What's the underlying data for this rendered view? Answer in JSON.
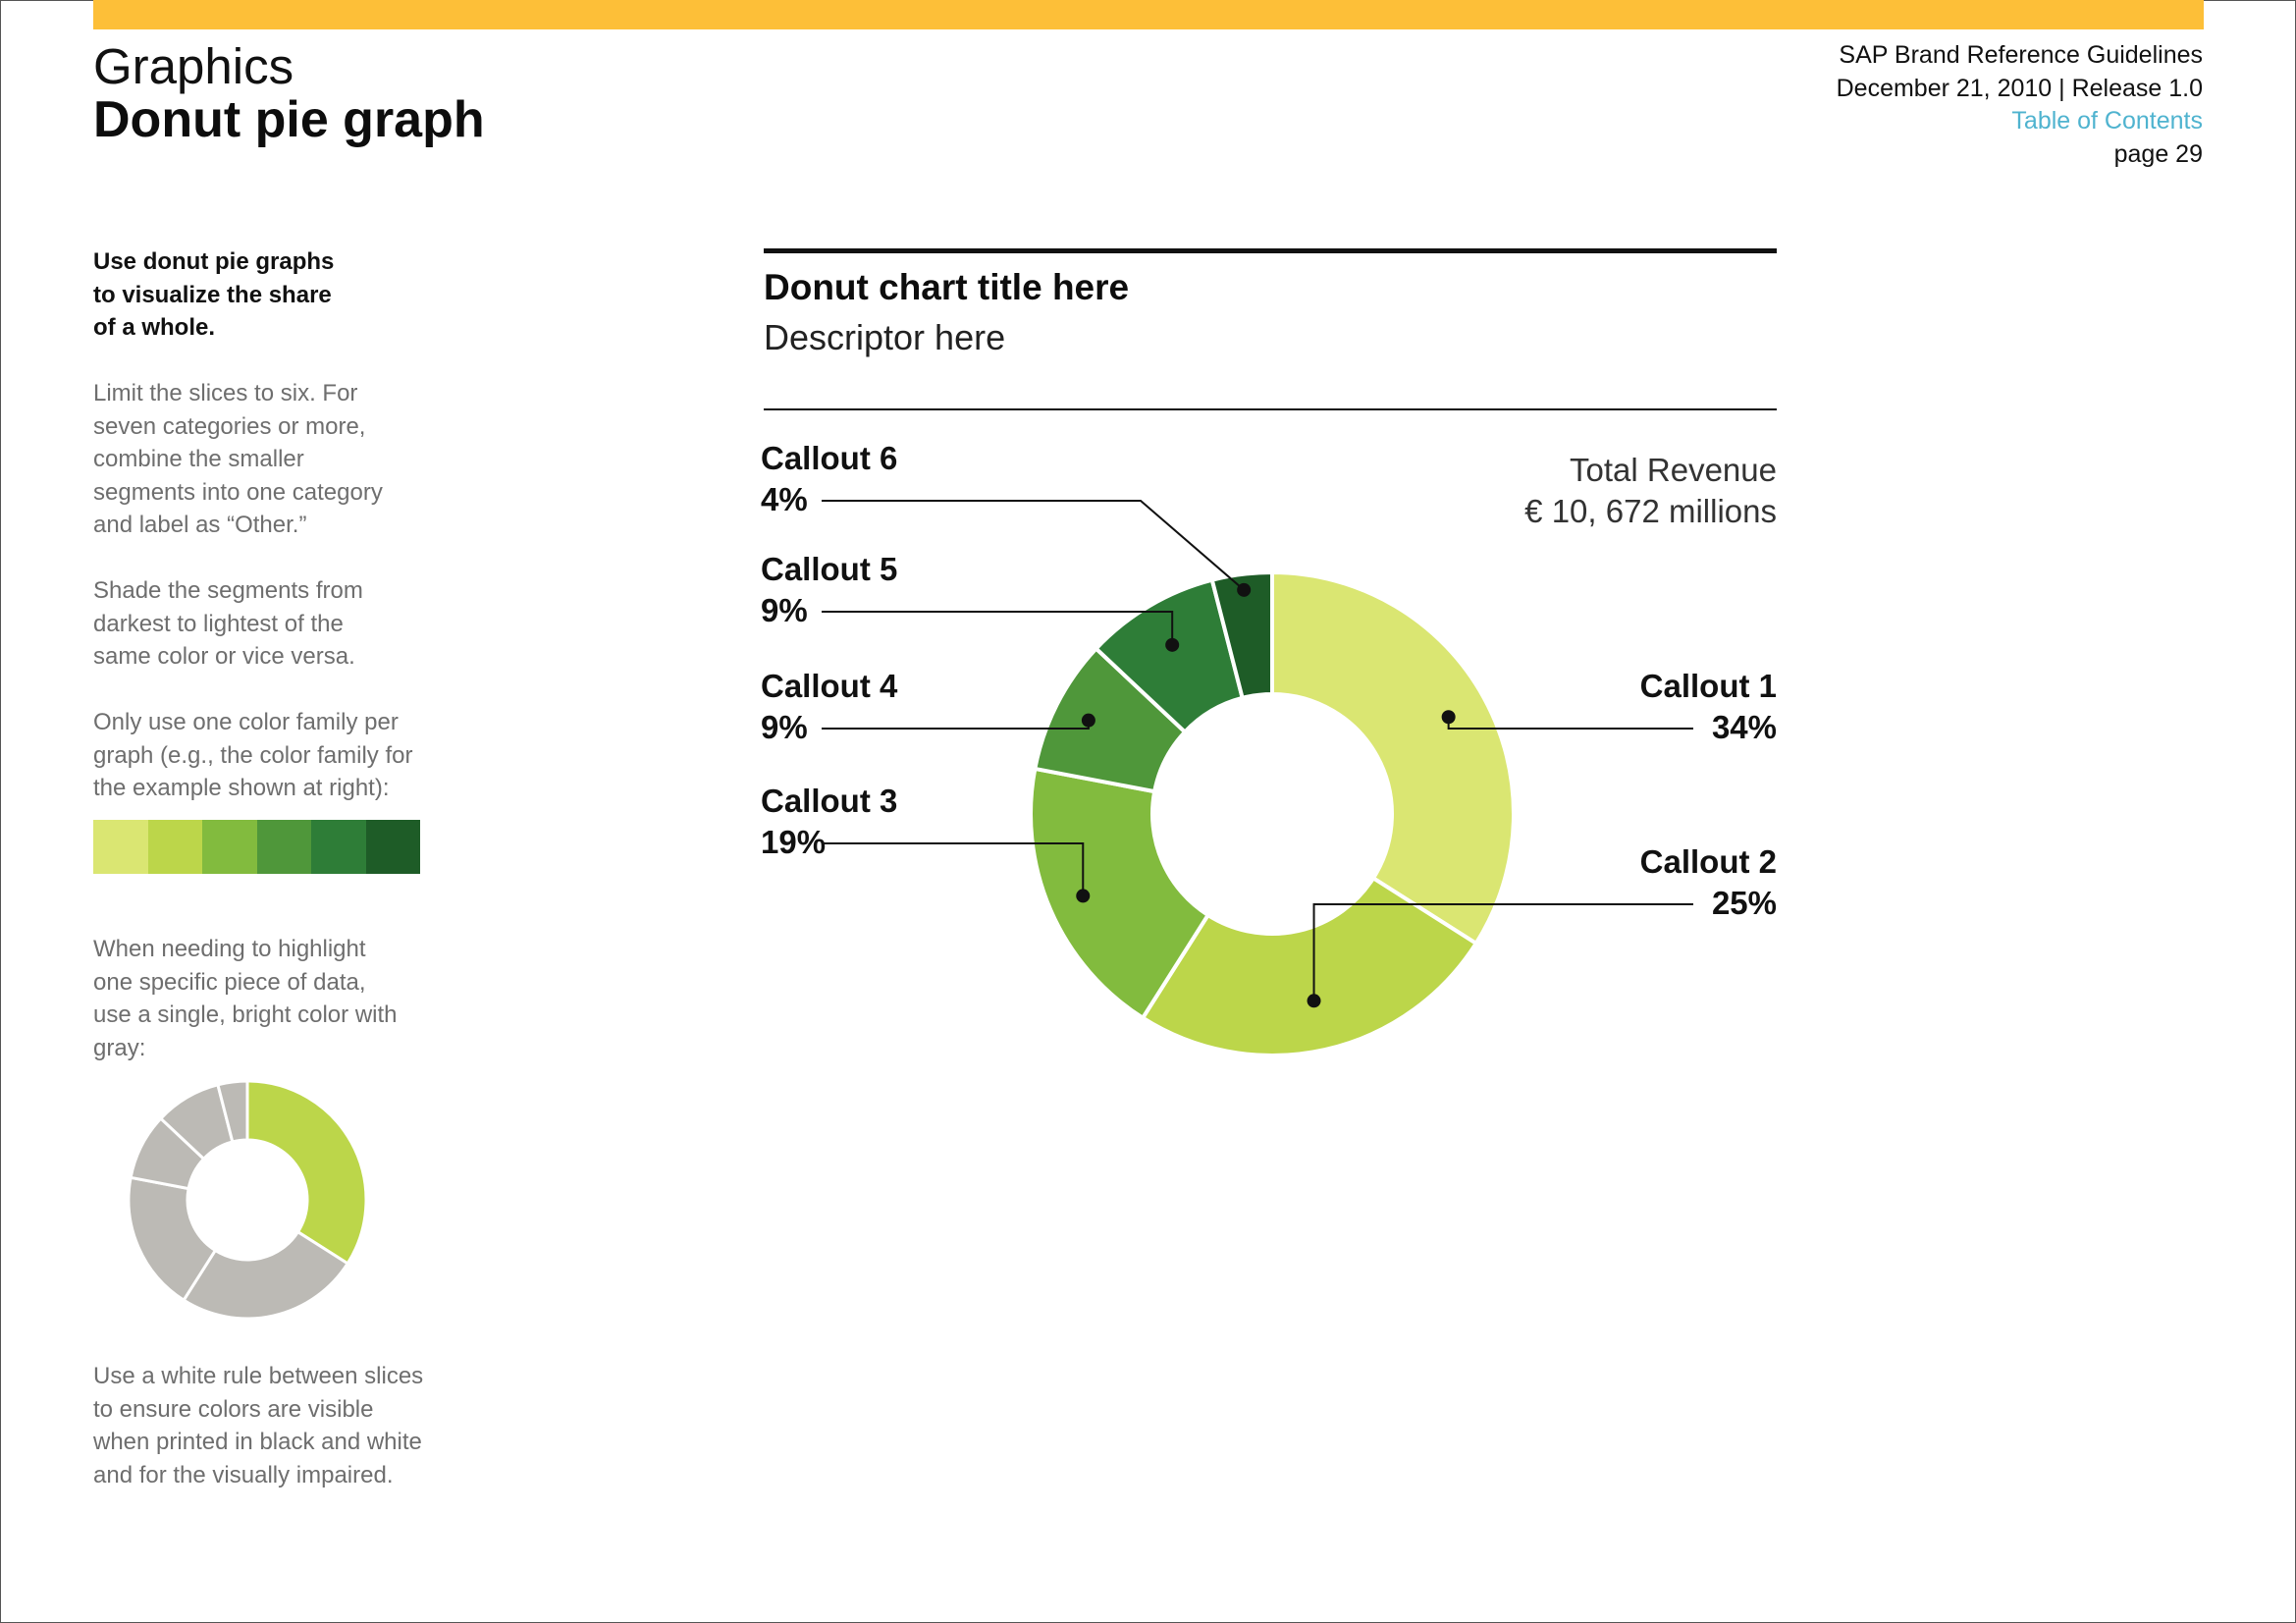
{
  "header": {
    "section": "Graphics",
    "title": "Donut pie graph",
    "doc_title": "SAP Brand Reference Guidelines",
    "date_release": "December 21, 2010 | Release 1.0",
    "toc_link": "Table of Contents",
    "page": "page 29"
  },
  "colors": {
    "accent_bar": "#FDBF38",
    "toc_link": "#4FB3CF",
    "green_family": [
      "#DAE672",
      "#BCD64A",
      "#82BB3E",
      "#4F973A",
      "#2E7D37",
      "#1E5C27"
    ],
    "highlight_gray": "#BCBAB5"
  },
  "sidebar": {
    "lead": "Use donut pie graphs to visualize the share of a whole.",
    "p1": "Limit the slices to six. For seven categories or more, combine the smaller segments into one category and label as “Other.”",
    "p2": "Shade the segments from darkest to lightest of the same color or vice versa.",
    "p3": "Only use one color family per graph (e.g., the color family for the example shown at right):",
    "p4": "When needing to highlight one specific piece of data, use a single, bright color with gray:",
    "p5": "Use a white rule between slices to ensure colors are visible when printed in black and white and for the visually impaired."
  },
  "chart_data": [
    {
      "type": "pie",
      "variant": "donut",
      "title": "Donut chart title here",
      "subtitle": "Descriptor here",
      "annotation": [
        "Total Revenue",
        "€ 10, 672 millions"
      ],
      "categories": [
        "Callout 1",
        "Callout 2",
        "Callout 3",
        "Callout 4",
        "Callout 5",
        "Callout 6"
      ],
      "values": [
        34,
        25,
        19,
        9,
        9,
        4
      ],
      "value_labels": [
        "34%",
        "25%",
        "19%",
        "9%",
        "9%",
        "4%"
      ],
      "colors": [
        "#DAE672",
        "#BCD64A",
        "#82BB3E",
        "#4F973A",
        "#2E7D37",
        "#1E5C27"
      ],
      "label_sides": [
        "right",
        "right",
        "left",
        "left",
        "left",
        "left"
      ]
    },
    {
      "type": "pie",
      "variant": "donut",
      "values": [
        34,
        25,
        19,
        9,
        9,
        4
      ],
      "colors": [
        "#BCD64A",
        "#BCBAB5",
        "#BCBAB5",
        "#BCBAB5",
        "#BCBAB5",
        "#BCBAB5"
      ]
    }
  ]
}
